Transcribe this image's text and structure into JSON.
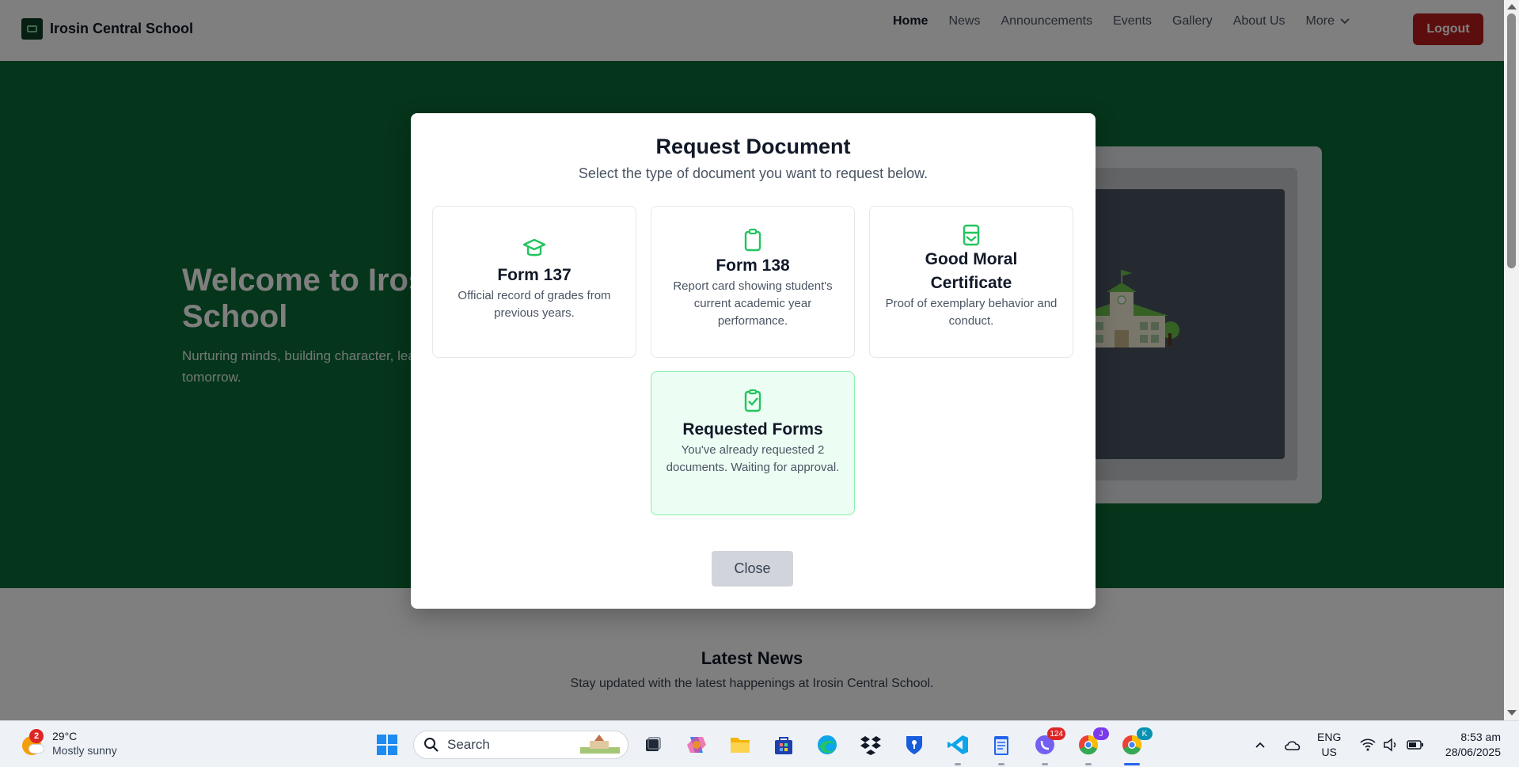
{
  "navbar": {
    "brand": "Irosin Central School",
    "links": [
      "Home",
      "News",
      "Announcements",
      "Events",
      "Gallery",
      "About Us"
    ],
    "more_label": "More",
    "logout_label": "Logout"
  },
  "hero": {
    "title": "Welcome to Irosin Central School",
    "subtitle": "Nurturing minds, building character, leaders of tomorrow."
  },
  "news": {
    "title": "Latest News",
    "subtitle": "Stay updated with the latest happenings at Irosin Central School."
  },
  "modal": {
    "title": "Request Document",
    "subtitle": "Select the type of document you want to request below.",
    "cards": [
      {
        "title": "Form 137",
        "desc": "Official record of grades from previous years.",
        "icon": "graduation-cap-icon"
      },
      {
        "title": "Form 138",
        "desc": "Report card showing student's current academic year performance.",
        "icon": "clipboard-icon"
      },
      {
        "title": "Good Moral Certificate",
        "desc": "Proof of exemplary behavior and conduct.",
        "icon": "certificate-icon"
      },
      {
        "title": "Requested Forms",
        "desc": "You've already requested 2 documents. Waiting for approval.",
        "icon": "clipboard-check-icon"
      }
    ],
    "close_label": "Close"
  },
  "taskbar": {
    "weather_temp": "29°C",
    "weather_desc": "Mostly sunny",
    "weather_badge": "2",
    "search_placeholder": "Search",
    "viber_badge": "124",
    "chrome_badge_1": "J",
    "chrome_badge_2": "K",
    "lang_line1": "ENG",
    "lang_line2": "US",
    "time": "8:53 am",
    "date": "28/06/2025"
  },
  "colors": {
    "brand_green": "#0a6b35",
    "accent_green": "#22c55e",
    "logout_red": "#b91c1c"
  }
}
